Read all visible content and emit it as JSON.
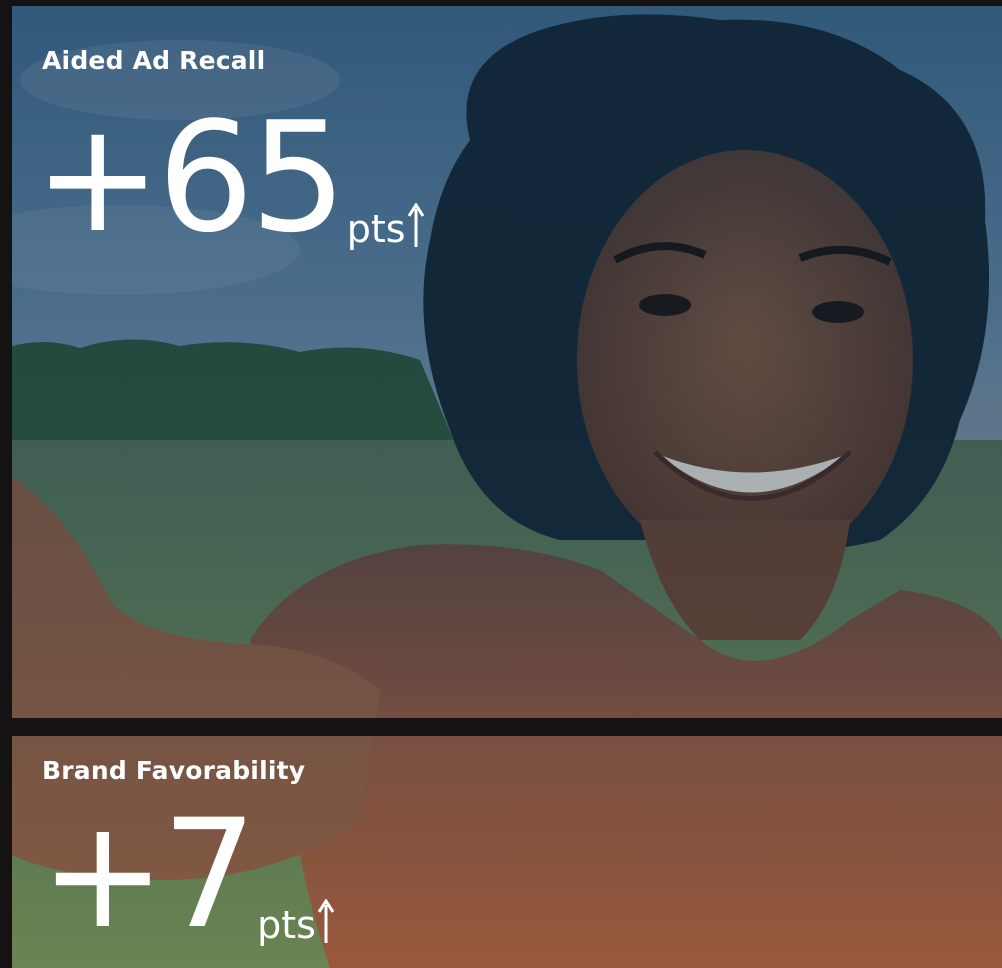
{
  "metrics": [
    {
      "label": "Aided Ad Recall",
      "value": "+65",
      "unit": "pts",
      "direction": "up",
      "icon": "arrow-up-icon"
    },
    {
      "label": "Brand Favorability",
      "value": "+7",
      "unit": "pts",
      "direction": "up",
      "icon": "arrow-up-icon"
    }
  ],
  "colors": {
    "background": "#141212",
    "text": "#ffffff",
    "overlay_top": "#1f3f5a",
    "shirt": "#9c5a3c"
  }
}
